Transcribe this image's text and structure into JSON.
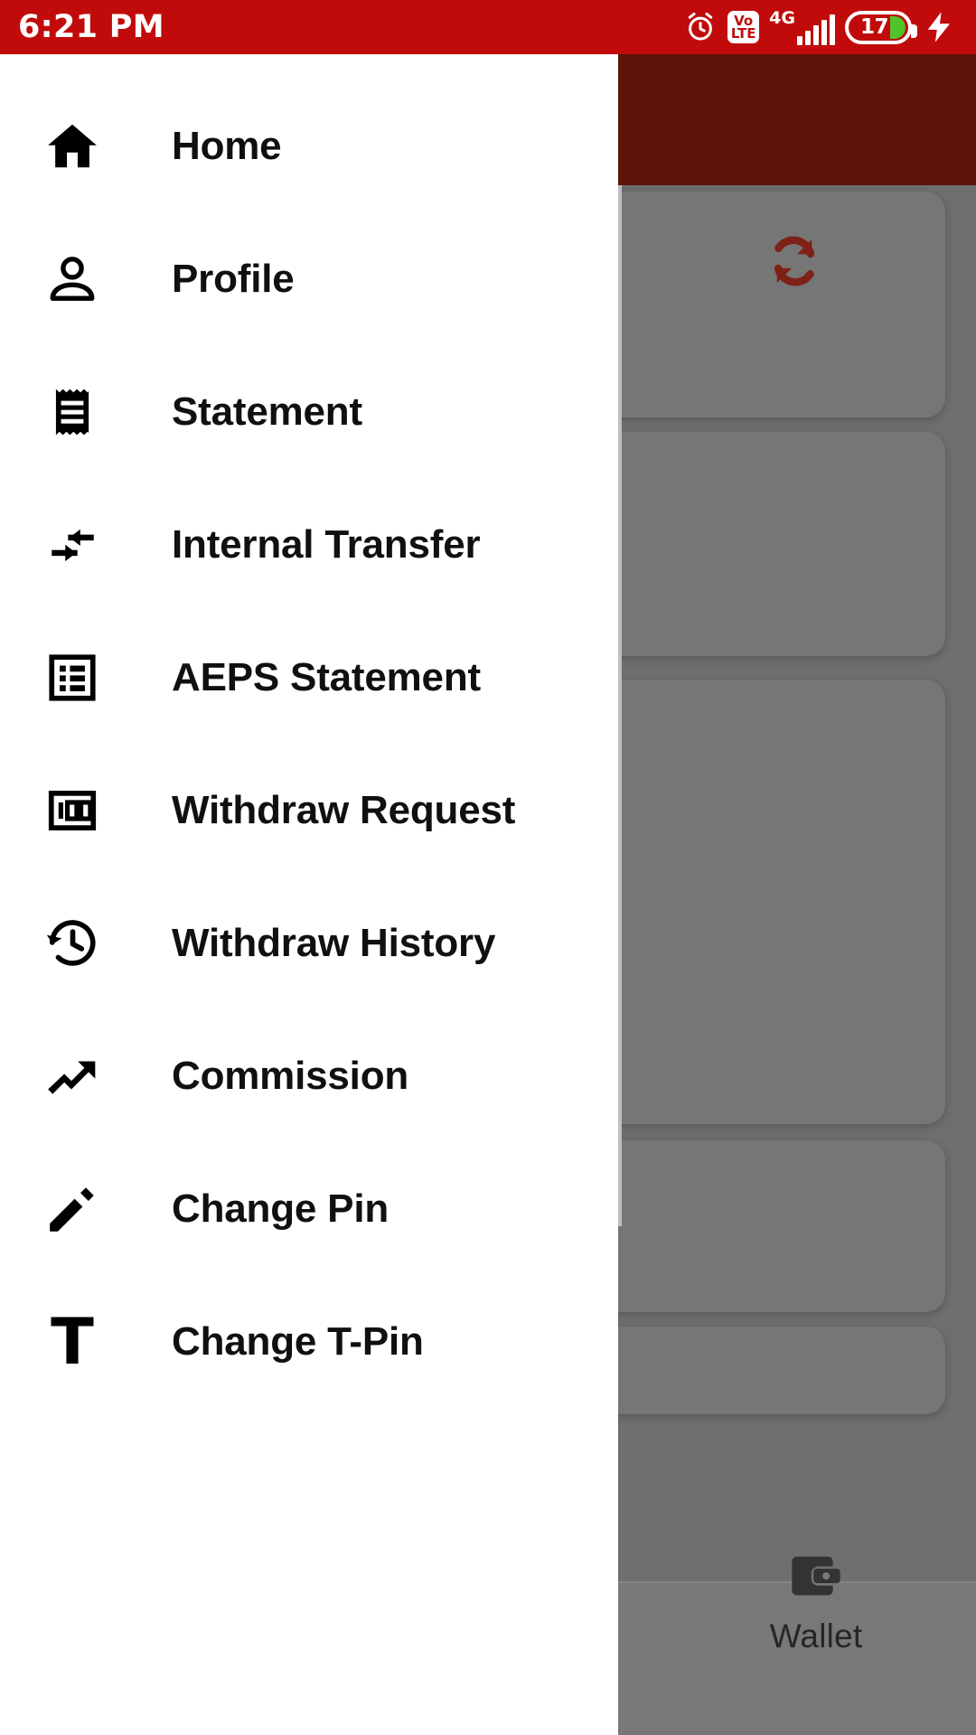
{
  "status_bar": {
    "time": "6:21 PM",
    "alarm_icon": "alarm-clock-icon",
    "volte_top": "Vo",
    "volte_bottom": "LTE",
    "network_type": "4G",
    "signal_icon": "signal-bars-icon",
    "battery_percent": "17",
    "charging_icon": "charging-bolt-icon",
    "background_color": "#c10b0b"
  },
  "drawer": {
    "items": [
      {
        "label": "Home",
        "icon": "home-icon"
      },
      {
        "label": "Profile",
        "icon": "person-icon"
      },
      {
        "label": "Statement",
        "icon": "receipt-icon"
      },
      {
        "label": "Internal Transfer",
        "icon": "swap-arrows-icon"
      },
      {
        "label": "AEPS Statement",
        "icon": "list-box-icon"
      },
      {
        "label": "Withdraw Request",
        "icon": "banknote-100-icon"
      },
      {
        "label": "Withdraw History",
        "icon": "history-clock-icon"
      },
      {
        "label": "Commission",
        "icon": "trending-up-icon"
      },
      {
        "label": "Change Pin",
        "icon": "pencil-icon"
      },
      {
        "label": "Change T-Pin",
        "icon": "letter-t-icon",
        "glyph": "T"
      }
    ]
  },
  "background_app": {
    "header_color": "#5e1509",
    "scrim_color": "#6f6f6f",
    "card_color": "#767676",
    "sync_icon": "refresh-sync-icon",
    "sync_icon_color": "#7e2116",
    "bottom_nav": {
      "items": [
        {
          "label": "Wallet",
          "icon": "wallet-icon"
        }
      ]
    }
  }
}
